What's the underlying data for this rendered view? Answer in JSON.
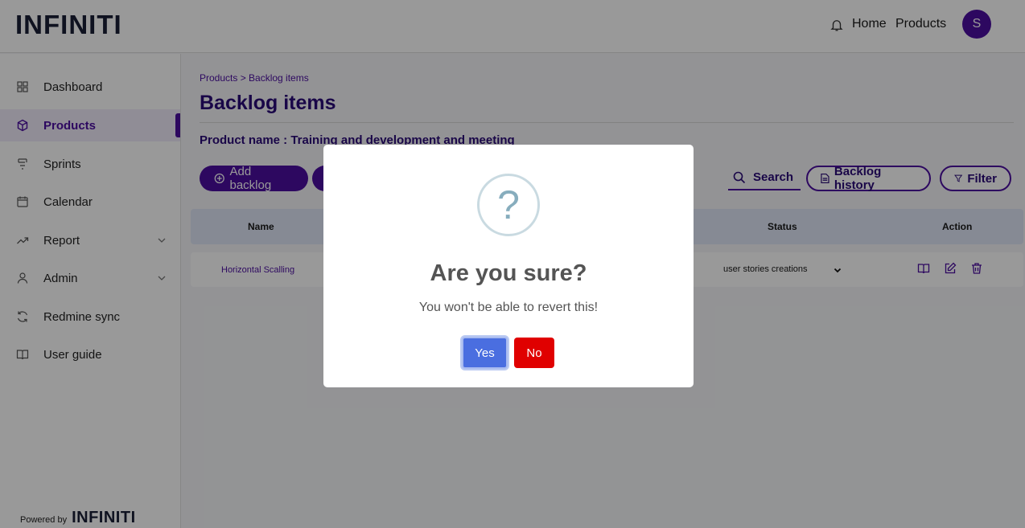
{
  "header": {
    "logo": "INFINITI",
    "nav": [
      {
        "label": "Home"
      },
      {
        "label": "Products"
      }
    ],
    "avatar_initial": "S"
  },
  "sidebar": {
    "items": [
      {
        "label": "Dashboard",
        "icon": "dashboard-icon"
      },
      {
        "label": "Products",
        "icon": "box-icon",
        "active": true
      },
      {
        "label": "Sprints",
        "icon": "sprint-icon"
      },
      {
        "label": "Calendar",
        "icon": "calendar-icon"
      },
      {
        "label": "Report",
        "icon": "trend-icon",
        "expandable": true
      },
      {
        "label": "Admin",
        "icon": "user-icon",
        "expandable": true
      },
      {
        "label": "Redmine sync",
        "icon": "sync-icon"
      },
      {
        "label": "User guide",
        "icon": "book-icon"
      }
    ],
    "powered_by": "Powered by",
    "powered_logo": "INFINITI"
  },
  "main": {
    "breadcrumb": "Products > Backlog items",
    "title": "Backlog items",
    "product_name": "Product name : Training and development and meeting",
    "buttons": {
      "add_backlog": "Add backlog",
      "search": "Search",
      "backlog_history": "Backlog history",
      "filter": "Filter"
    },
    "table": {
      "headers": [
        "Name",
        "Status",
        "Action"
      ],
      "rows": [
        {
          "name": "Horizontal Scalling",
          "status": "user stories creations"
        }
      ]
    }
  },
  "modal": {
    "icon": "?",
    "title": "Are you sure?",
    "text": "You won't be able to revert this!",
    "yes_label": "Yes",
    "no_label": "No"
  },
  "colors": {
    "brand": "#4b0ea0",
    "yes": "#4a6ee0",
    "no": "#e00000",
    "logo_accent": "#e8581c"
  }
}
